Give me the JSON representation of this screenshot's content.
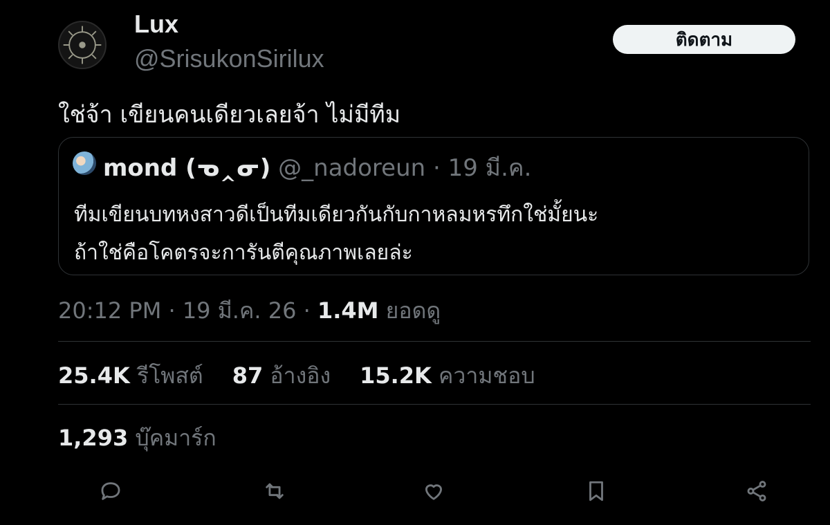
{
  "author": {
    "name": "Lux",
    "handle": "@SrisukonSirilux",
    "follow_label": "ติดตาม"
  },
  "tweet": {
    "text": "ใช่จ้า เขียนคนเดียวเลยจ้า ไม่มีทีม"
  },
  "quoted": {
    "name": "mond (ᓀ‸ᓂ)",
    "handle": "@_nadoreun",
    "date": "19 มี.ค.",
    "line1": "ทีมเขียนบทหงสาวดีเป็นทีมเดียวกันกับกาหลมหรทึกใช่มั้ยนะ",
    "line2": "ถ้าใช่คือโคตรจะการันตีคุณภาพเลยล่ะ"
  },
  "meta": {
    "time": "20:12 PM",
    "date": "19 มี.ค. 26",
    "views": "1.4M",
    "views_label": "ยอดดู"
  },
  "stats": {
    "reposts": "25.4K",
    "reposts_label": "รีโพสต์",
    "quotes": "87",
    "quotes_label": "อ้างอิง",
    "likes": "15.2K",
    "likes_label": "ความชอบ"
  },
  "bookmarks": {
    "count": "1,293",
    "label": "บุ๊คมาร์ก"
  },
  "icons": [
    "reply-icon",
    "repost-icon",
    "like-icon",
    "bookmark-icon",
    "share-icon"
  ],
  "colors": {
    "background": "#000000",
    "text": "#e7e9ea",
    "muted": "#71767b",
    "divider": "#2f3336"
  }
}
